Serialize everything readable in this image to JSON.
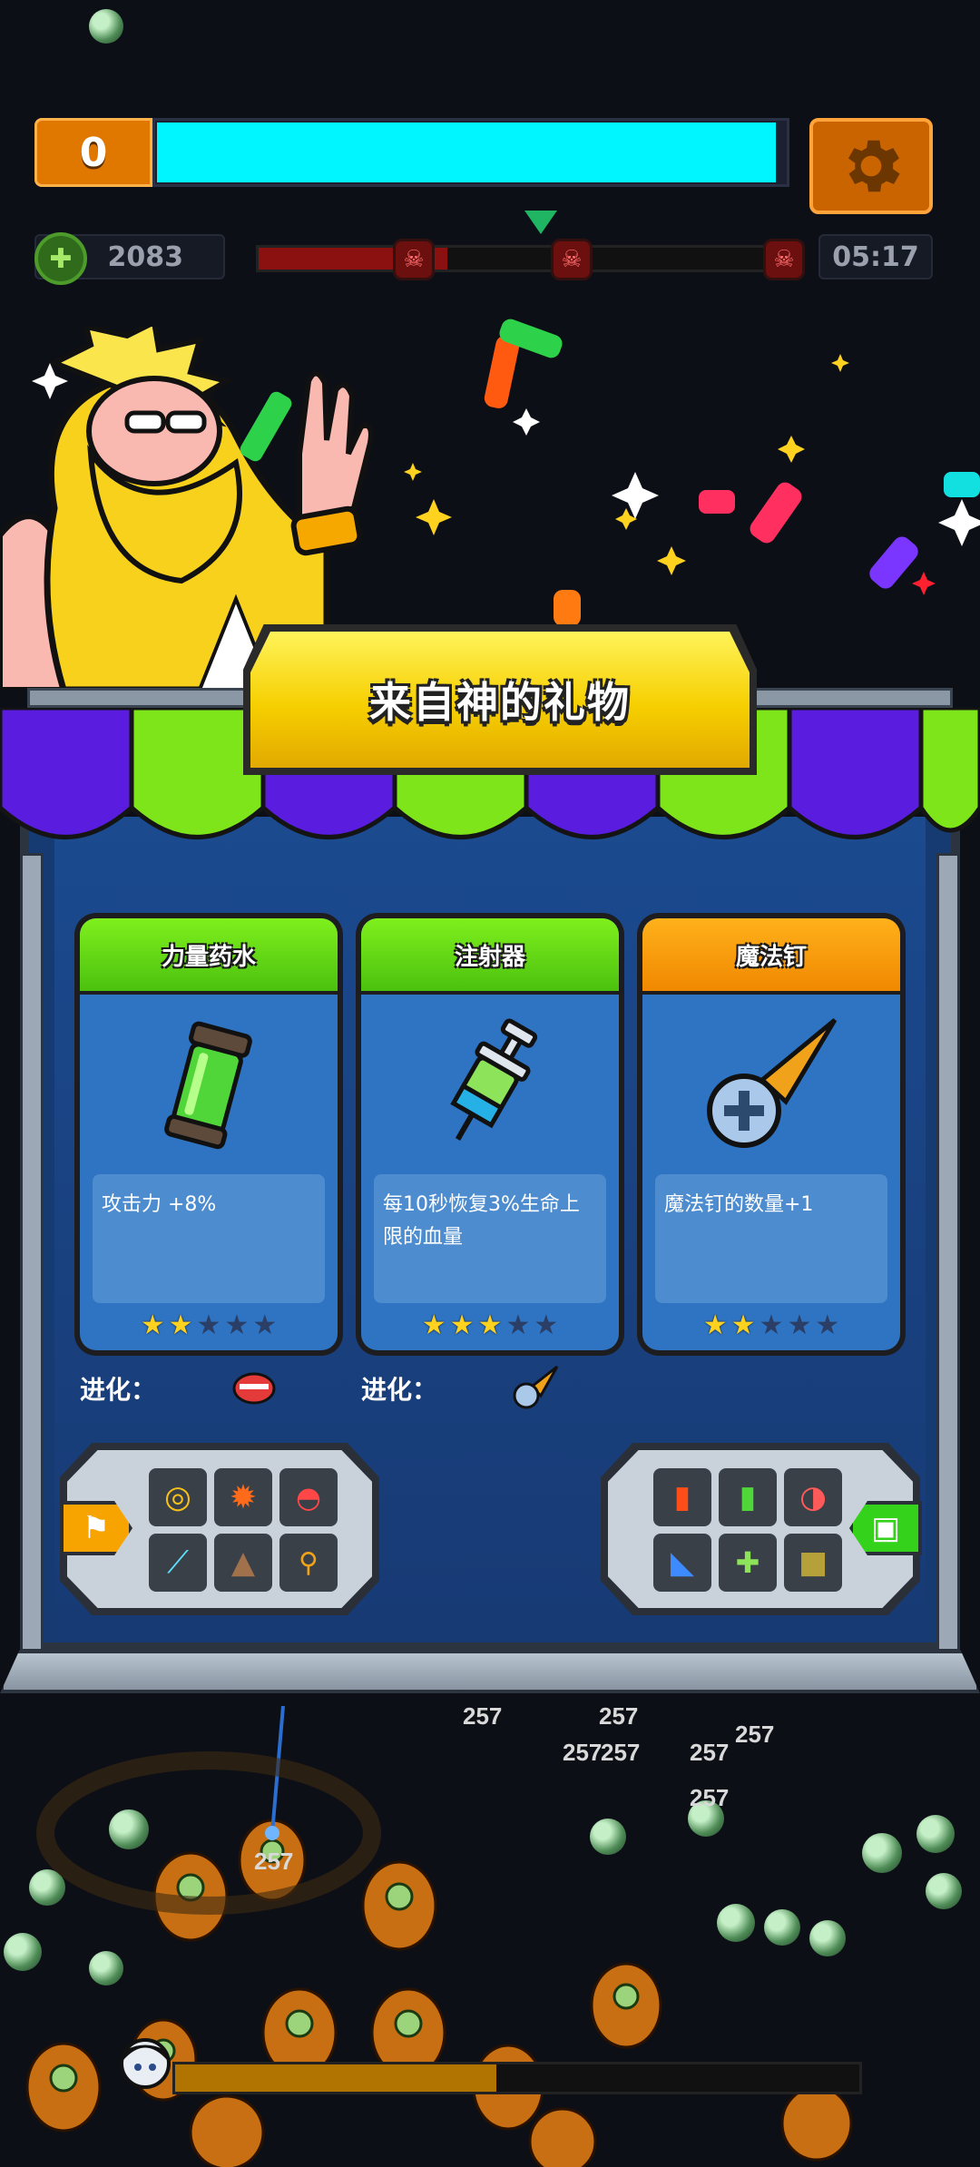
{
  "hud": {
    "level": "0",
    "xp_progress": 0.98,
    "coins": "2083",
    "timer": "05:17",
    "boss_progress": 0.35
  },
  "shop": {
    "title": "来自神的礼物",
    "cards": [
      {
        "name": "力量药水",
        "desc": "攻击力 +8%",
        "stars": 2,
        "max_stars": 5,
        "header_color": "#5bd314",
        "icon": "power-potion-icon"
      },
      {
        "name": "注射器",
        "desc": "每10秒恢复3%生命上限的血量",
        "stars": 3,
        "max_stars": 5,
        "header_color": "#5bd314",
        "icon": "syringe-icon"
      },
      {
        "name": "魔法钉",
        "desc": "魔法钉的数量+1",
        "stars": 2,
        "max_stars": 5,
        "header_color": "#f59400",
        "icon": "magic-nail-icon"
      }
    ],
    "evolution_label": "进化："
  },
  "bottom": {
    "hp_progress": 0.47
  },
  "colors": {
    "xp": "#00f6ff",
    "level_badge": "#e07800",
    "shop_blue": "#19407e",
    "awning_green": "#7ee51b",
    "awning_purple": "#5a1de0",
    "title_yellow": "#f6cf00"
  }
}
